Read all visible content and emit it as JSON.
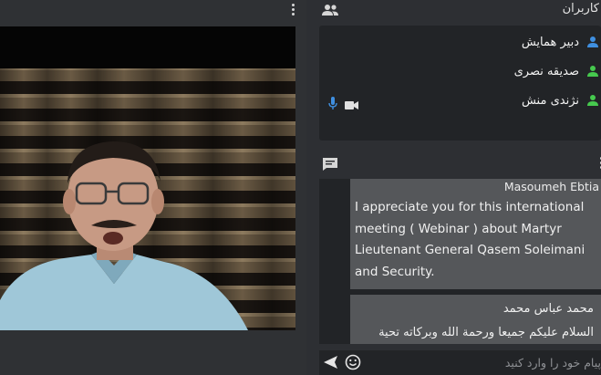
{
  "video": {
    "menu_icon": "more-vert-icon"
  },
  "users": {
    "title": "کاربران",
    "header_icon": "people-icon",
    "list": [
      {
        "name": "دبیر همایش",
        "icon": "person-icon",
        "color": "#3f8fe0"
      },
      {
        "name": "صدیقه نصری",
        "icon": "person-icon",
        "color": "#46c94e"
      },
      {
        "name": "نژندی منش",
        "icon": "person-icon",
        "color": "#46c94e"
      }
    ],
    "media_icons": [
      "mic-icon",
      "videocam-icon"
    ],
    "mic_color": "#3f8fe0"
  },
  "chat": {
    "header_icon": "chat-icon",
    "messages": [
      {
        "author": "Masoumeh Ebtia",
        "text": "I appreciate you for this international meeting ( Webinar ) about Martyr Lieutenant General Qasem Soleimani and Security."
      },
      {
        "author": "محمد عباس محمد",
        "text": "السلام علیکم جمیعا ورحمة الله وبرکاته تحیة"
      }
    ],
    "input_placeholder": "پیام خود را وارد کنید",
    "send_icon": "send-icon",
    "emoji_icon": "emoji-icon"
  },
  "colors": {
    "background": "#2d2f33",
    "panel_inner": "#222427",
    "message_bubble": "#55575a",
    "online_green": "#46c94e",
    "moderator_blue": "#3f8fe0"
  }
}
